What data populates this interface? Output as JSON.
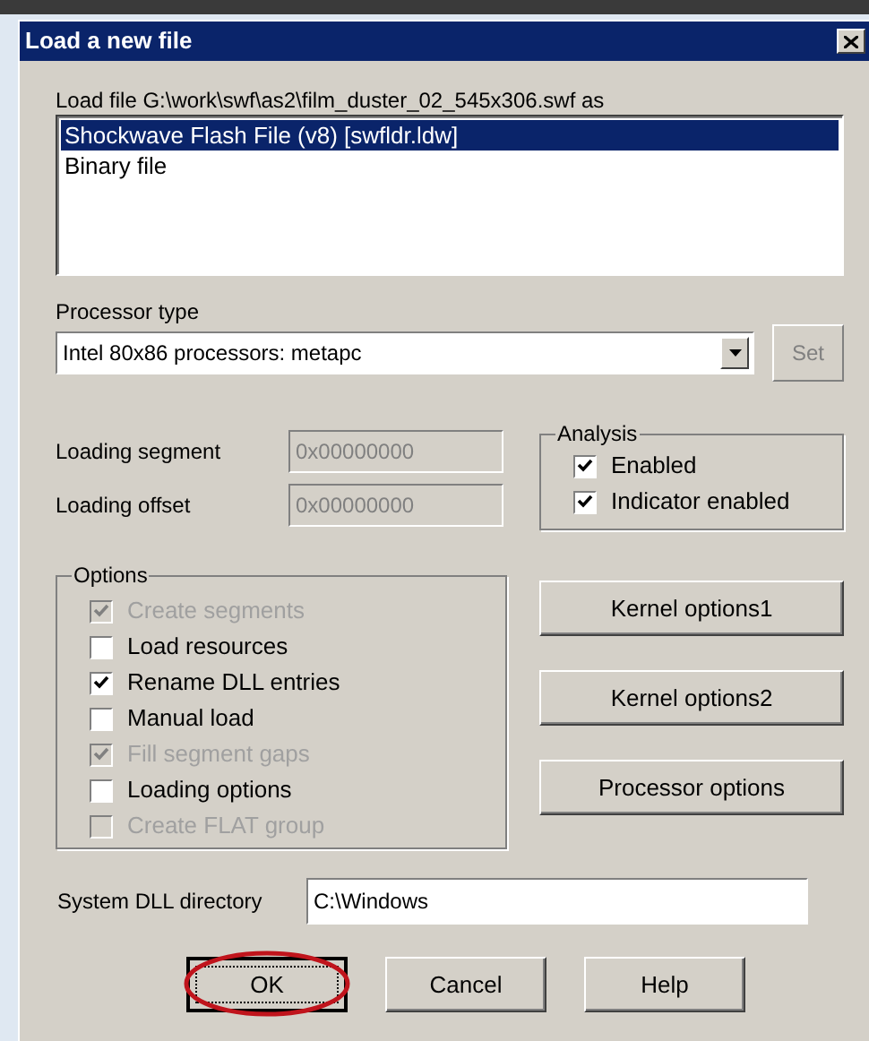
{
  "window": {
    "title": "Load a new file"
  },
  "load_file_label": "Load file G:\\work\\swf\\as2\\film_duster_02_545x306.swf as",
  "formats": [
    {
      "label": "Shockwave Flash File (v8) [swfldr.ldw]",
      "selected": true
    },
    {
      "label": "Binary file",
      "selected": false
    }
  ],
  "processor": {
    "label": "Processor type",
    "value": "Intel 80x86 processors: metapc",
    "set_button": {
      "label": "Set",
      "disabled": true
    }
  },
  "loading_fields": [
    {
      "label": "Loading segment",
      "value": "0x00000000"
    },
    {
      "label": "Loading offset",
      "value": "0x00000000"
    }
  ],
  "analysis": {
    "title": "Analysis",
    "items": [
      {
        "label": "Enabled",
        "checked": true,
        "disabled": false
      },
      {
        "label": "Indicator enabled",
        "checked": true,
        "disabled": false
      }
    ]
  },
  "options": {
    "title": "Options",
    "items": [
      {
        "label": "Create segments",
        "checked": true,
        "disabled": true
      },
      {
        "label": "Load resources",
        "checked": false,
        "disabled": false
      },
      {
        "label": "Rename DLL entries",
        "checked": true,
        "disabled": false
      },
      {
        "label": "Manual load",
        "checked": false,
        "disabled": false
      },
      {
        "label": "Fill segment gaps",
        "checked": true,
        "disabled": true
      },
      {
        "label": "Loading options",
        "checked": false,
        "disabled": false
      },
      {
        "label": "Create FLAT group",
        "checked": false,
        "disabled": true
      }
    ]
  },
  "side_buttons": [
    "Kernel options1",
    "Kernel options2",
    "Processor options"
  ],
  "dll_directory": {
    "label": "System DLL directory",
    "value": "C:\\Windows"
  },
  "buttons": [
    {
      "label": "OK",
      "default": true,
      "circled": true
    },
    {
      "label": "Cancel",
      "default": false,
      "circled": false
    },
    {
      "label": "Help",
      "default": false,
      "circled": false
    }
  ]
}
